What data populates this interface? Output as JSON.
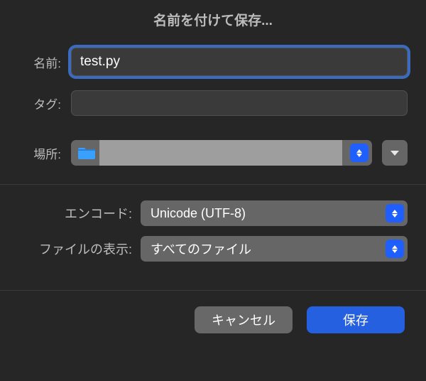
{
  "title": "名前を付けて保存...",
  "labels": {
    "name": "名前:",
    "tags": "タグ:",
    "location": "場所:",
    "encoding": "エンコード:",
    "fileDisplay": "ファイルの表示:"
  },
  "values": {
    "filename": "test.py",
    "tags": "",
    "encoding": "Unicode (UTF-8)",
    "fileDisplay": "すべてのファイル"
  },
  "buttons": {
    "cancel": "キャンセル",
    "save": "保存"
  }
}
